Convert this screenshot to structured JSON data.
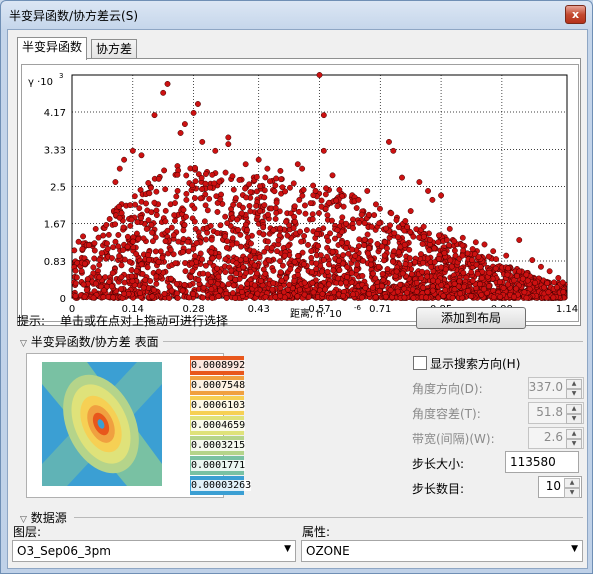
{
  "window": {
    "title": "半变异函数/协方差云(S)",
    "close_glyph": "x"
  },
  "tabs": [
    {
      "label": "半变异函数"
    },
    {
      "label": "协方差"
    }
  ],
  "chart_data": {
    "type": "scatter",
    "y_axis_label": "γ ·10",
    "y_axis_exponent": "3",
    "x_axis_label": "距离, h· 10",
    "x_axis_exponent": "-6",
    "y_ticks": [
      "0",
      "0.83",
      "1.67",
      "2.5",
      "3.33",
      "4.17"
    ],
    "x_ticks": [
      "0",
      "0.14",
      "0.28",
      "0.43",
      "0.57",
      "0.71",
      "0.85",
      "0.99",
      "1.14"
    ],
    "xlim": [
      0,
      1.14
    ],
    "ylim": [
      0,
      5.0
    ],
    "grid": true,
    "point_color": "#cc1111",
    "points": [
      [
        0.22,
        4.8
      ],
      [
        0.21,
        4.6
      ],
      [
        0.57,
        5.0
      ],
      [
        0.58,
        4.1
      ],
      [
        0.29,
        4.35
      ],
      [
        0.28,
        4.15
      ],
      [
        0.19,
        4.1
      ],
      [
        0.36,
        3.6
      ],
      [
        0.36,
        3.45
      ],
      [
        0.3,
        3.5
      ],
      [
        0.52,
        3.0
      ],
      [
        0.53,
        2.9
      ],
      [
        0.58,
        3.3
      ],
      [
        0.6,
        2.75
      ],
      [
        0.73,
        3.5
      ],
      [
        0.74,
        3.3
      ],
      [
        0.76,
        2.7
      ],
      [
        0.8,
        2.6
      ],
      [
        0.82,
        2.4
      ],
      [
        0.83,
        2.2
      ],
      [
        0.85,
        2.3
      ],
      [
        0.87,
        1.55
      ],
      [
        0.9,
        1.35
      ],
      [
        0.93,
        1.25
      ],
      [
        0.95,
        1.2
      ],
      [
        0.97,
        1.05
      ],
      [
        1.0,
        0.95
      ],
      [
        1.03,
        1.3
      ],
      [
        1.06,
        0.85
      ],
      [
        1.1,
        0.6
      ],
      [
        1.12,
        0.45
      ],
      [
        1.13,
        0.35
      ],
      [
        1.08,
        0.7
      ],
      [
        0.12,
        3.1
      ],
      [
        0.14,
        3.3
      ],
      [
        0.16,
        3.2
      ],
      [
        0.11,
        2.9
      ],
      [
        0.1,
        2.6
      ],
      [
        0.4,
        3.0
      ],
      [
        0.43,
        3.1
      ],
      [
        0.45,
        2.9
      ],
      [
        0.48,
        2.85
      ],
      [
        0.66,
        2.2
      ],
      [
        0.68,
        2.4
      ],
      [
        0.7,
        2.1
      ],
      [
        0.78,
        1.95
      ],
      [
        0.81,
        1.6
      ],
      [
        0.26,
        3.9
      ],
      [
        0.33,
        3.3
      ],
      [
        0.25,
        3.7
      ]
    ],
    "cloud_seed": 7,
    "cloud_count": 2600
  },
  "hint": {
    "label": "提示:",
    "text": "单击或在点对上拖动可进行选择"
  },
  "add_to_layout_button": "添加到布局",
  "surface_section": {
    "title": "半变异函数/协方差 表面",
    "legend": [
      "0.0008992",
      "0.0007548",
      "0.0006103",
      "0.0004659",
      "0.0003215",
      "0.0001771",
      "0.00003263"
    ],
    "legend_colors": [
      "#e8571c",
      "#f0a040",
      "#f6d054",
      "#dfe27a",
      "#b5d48a",
      "#79c1a3",
      "#3b9fd3"
    ]
  },
  "search_direction": {
    "checkbox_label": "显示搜索方向(H)",
    "checked": false,
    "angle_direction_label": "角度方向(D):",
    "angle_direction_value": "337.0",
    "angle_tolerance_label": "角度容差(T):",
    "angle_tolerance_value": "51.8",
    "bandwidth_label": "带宽(间隔)(W):",
    "bandwidth_value": "2.6"
  },
  "lag": {
    "size_label": "步长大小:",
    "size_value": "113580",
    "count_label": "步长数目:",
    "count_value": "10"
  },
  "data_source": {
    "title": "数据源",
    "layer_label": "图层:",
    "layer_value": "O3_Sep06_3pm",
    "attribute_label": "属性:",
    "attribute_value": "OZONE"
  }
}
